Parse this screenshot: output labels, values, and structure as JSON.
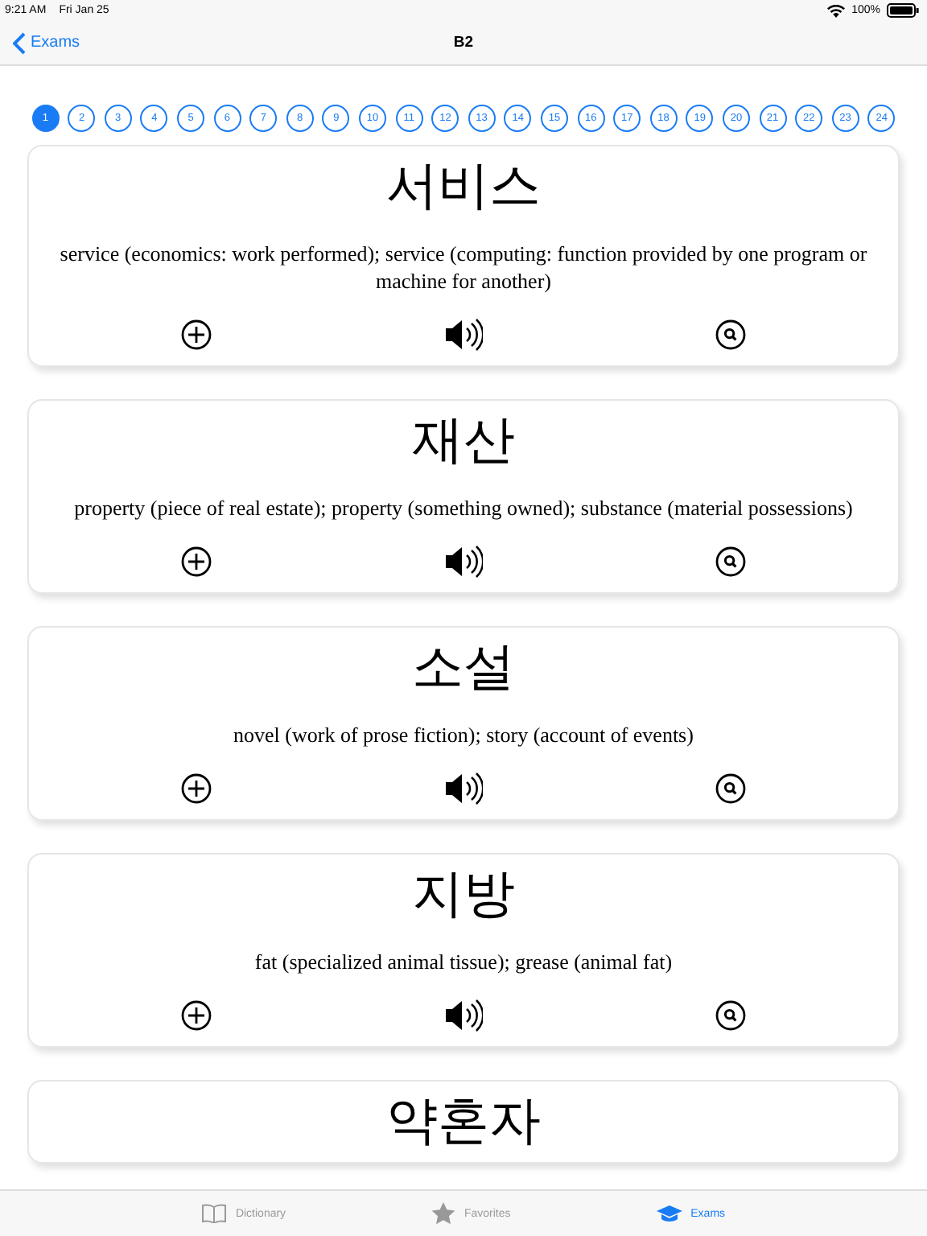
{
  "status_bar": {
    "time": "9:21 AM",
    "date": "Fri Jan 25",
    "battery": "100%"
  },
  "nav": {
    "back": "Exams",
    "title": "B2"
  },
  "pages": [
    {
      "label": "1",
      "selected": true
    },
    {
      "label": "2",
      "selected": false
    },
    {
      "label": "3",
      "selected": false
    },
    {
      "label": "4",
      "selected": false
    },
    {
      "label": "5",
      "selected": false
    },
    {
      "label": "6",
      "selected": false
    },
    {
      "label": "7",
      "selected": false
    },
    {
      "label": "8",
      "selected": false
    },
    {
      "label": "9",
      "selected": false
    },
    {
      "label": "10",
      "selected": false
    },
    {
      "label": "11",
      "selected": false
    },
    {
      "label": "12",
      "selected": false
    },
    {
      "label": "13",
      "selected": false
    },
    {
      "label": "14",
      "selected": false
    },
    {
      "label": "15",
      "selected": false
    },
    {
      "label": "16",
      "selected": false
    },
    {
      "label": "17",
      "selected": false
    },
    {
      "label": "18",
      "selected": false
    },
    {
      "label": "19",
      "selected": false
    },
    {
      "label": "20",
      "selected": false
    },
    {
      "label": "21",
      "selected": false
    },
    {
      "label": "22",
      "selected": false
    },
    {
      "label": "23",
      "selected": false
    },
    {
      "label": "24",
      "selected": false
    }
  ],
  "cards": [
    {
      "word": "서비스",
      "definition": "service (economics: work performed); service (computing: function provided by one program or machine for another)"
    },
    {
      "word": "재산",
      "definition": "property (piece of real estate); property (something owned); substance (material possessions)"
    },
    {
      "word": "소설",
      "definition": "novel (work of prose fiction); story (account of events)"
    },
    {
      "word": "지방",
      "definition": "fat (specialized animal tissue); grease (animal fat)"
    },
    {
      "word": "약혼자"
    }
  ],
  "tab_bar": [
    {
      "label": "Dictionary",
      "selected": false,
      "kind": "book"
    },
    {
      "label": "Favorites",
      "selected": false,
      "kind": "star"
    },
    {
      "label": "Exams",
      "selected": true,
      "kind": "cap"
    }
  ]
}
